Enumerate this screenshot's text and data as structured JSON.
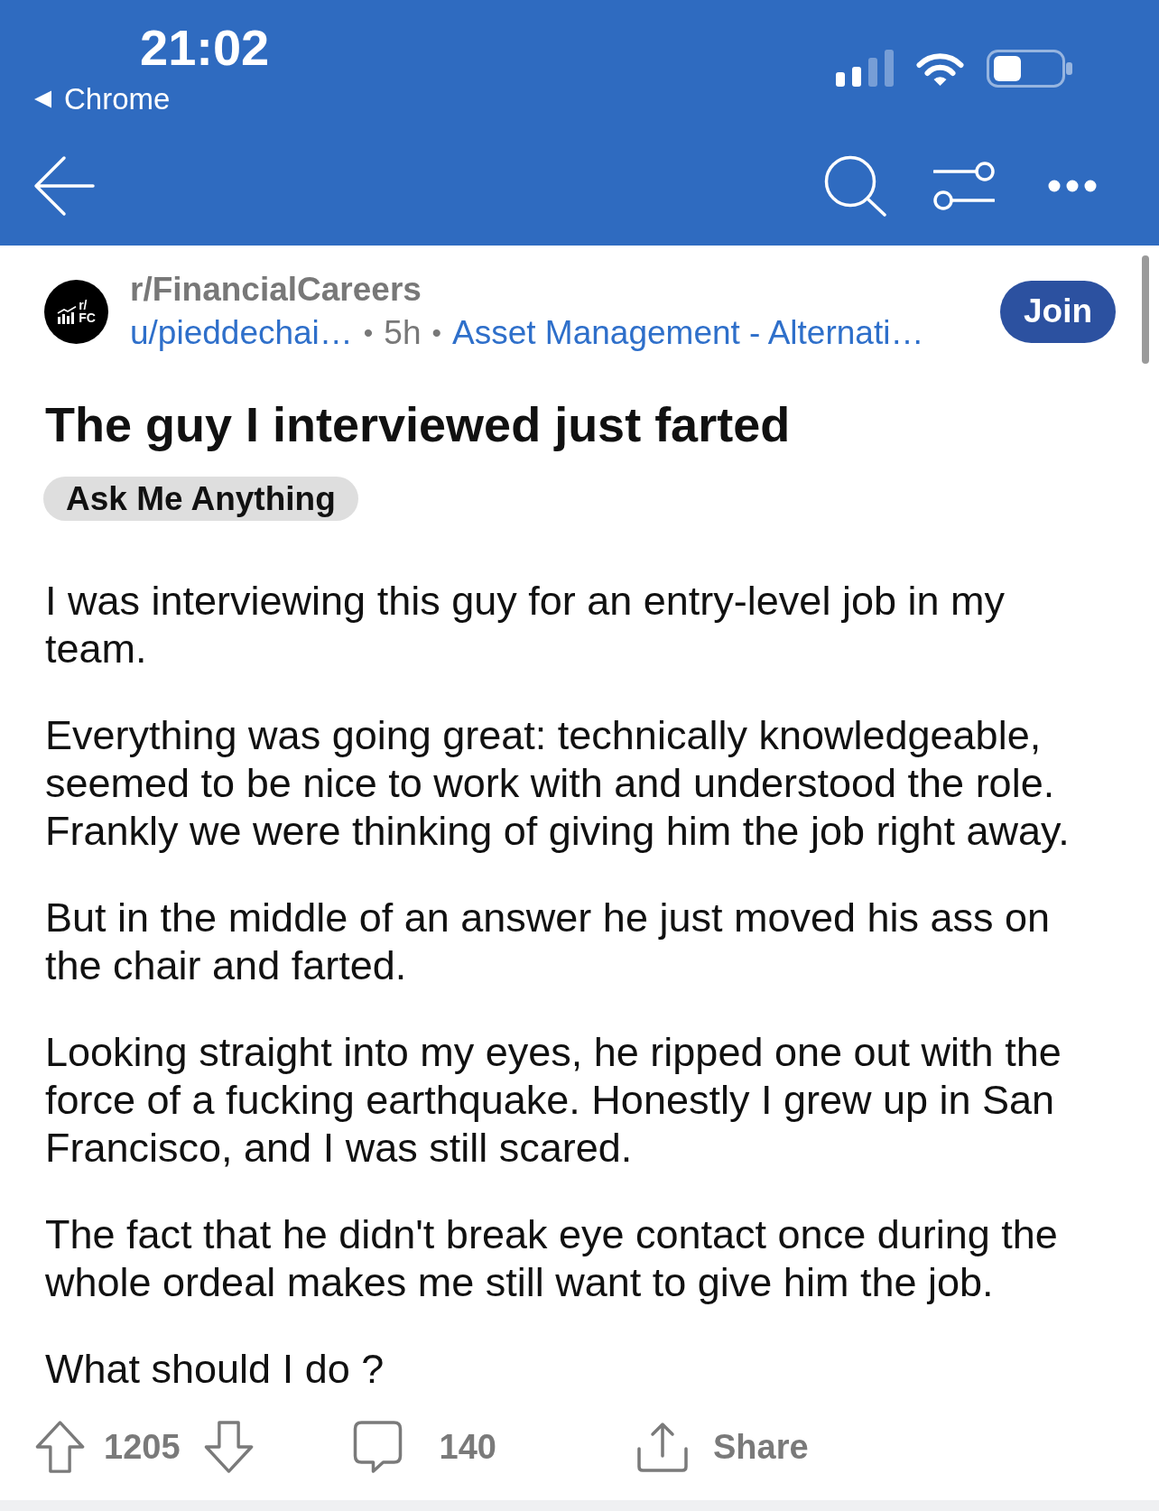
{
  "status_bar": {
    "time": "21:02",
    "back_app": "Chrome"
  },
  "post": {
    "subreddit": "r/FinancialCareers",
    "avatar_text": [
      "r/",
      "FC"
    ],
    "meta": [
      {
        "kind": "author",
        "text": "u/pieddechai…"
      },
      {
        "kind": "separator",
        "text": "•"
      },
      {
        "kind": "age",
        "text": "5h"
      },
      {
        "kind": "separator",
        "text": "•"
      },
      {
        "kind": "flair",
        "text": "Asset Management - Alternati…"
      }
    ],
    "join_button": "Join",
    "title": "The guy I interviewed just farted",
    "flair": "Ask Me Anything",
    "body": [
      "I was interviewing this guy for an entry-level job in my team.",
      "Everything was going great: technically knowledgeable, seemed to be nice to work with and understood the role. Frankly we were thinking of giving him the job right away.",
      "But in the middle of an answer he just moved his ass on the chair and farted.",
      "Looking straight into my eyes, he ripped one out with the force of a fucking earthquake. Honestly I grew up in San Francisco, and I was still scared.",
      "The fact that he didn't break eye contact once during the whole ordeal makes me still want to give him the job.",
      "What should I do ?"
    ]
  },
  "actions": {
    "upvotes": "1205",
    "comments": "140",
    "share": "Share"
  }
}
